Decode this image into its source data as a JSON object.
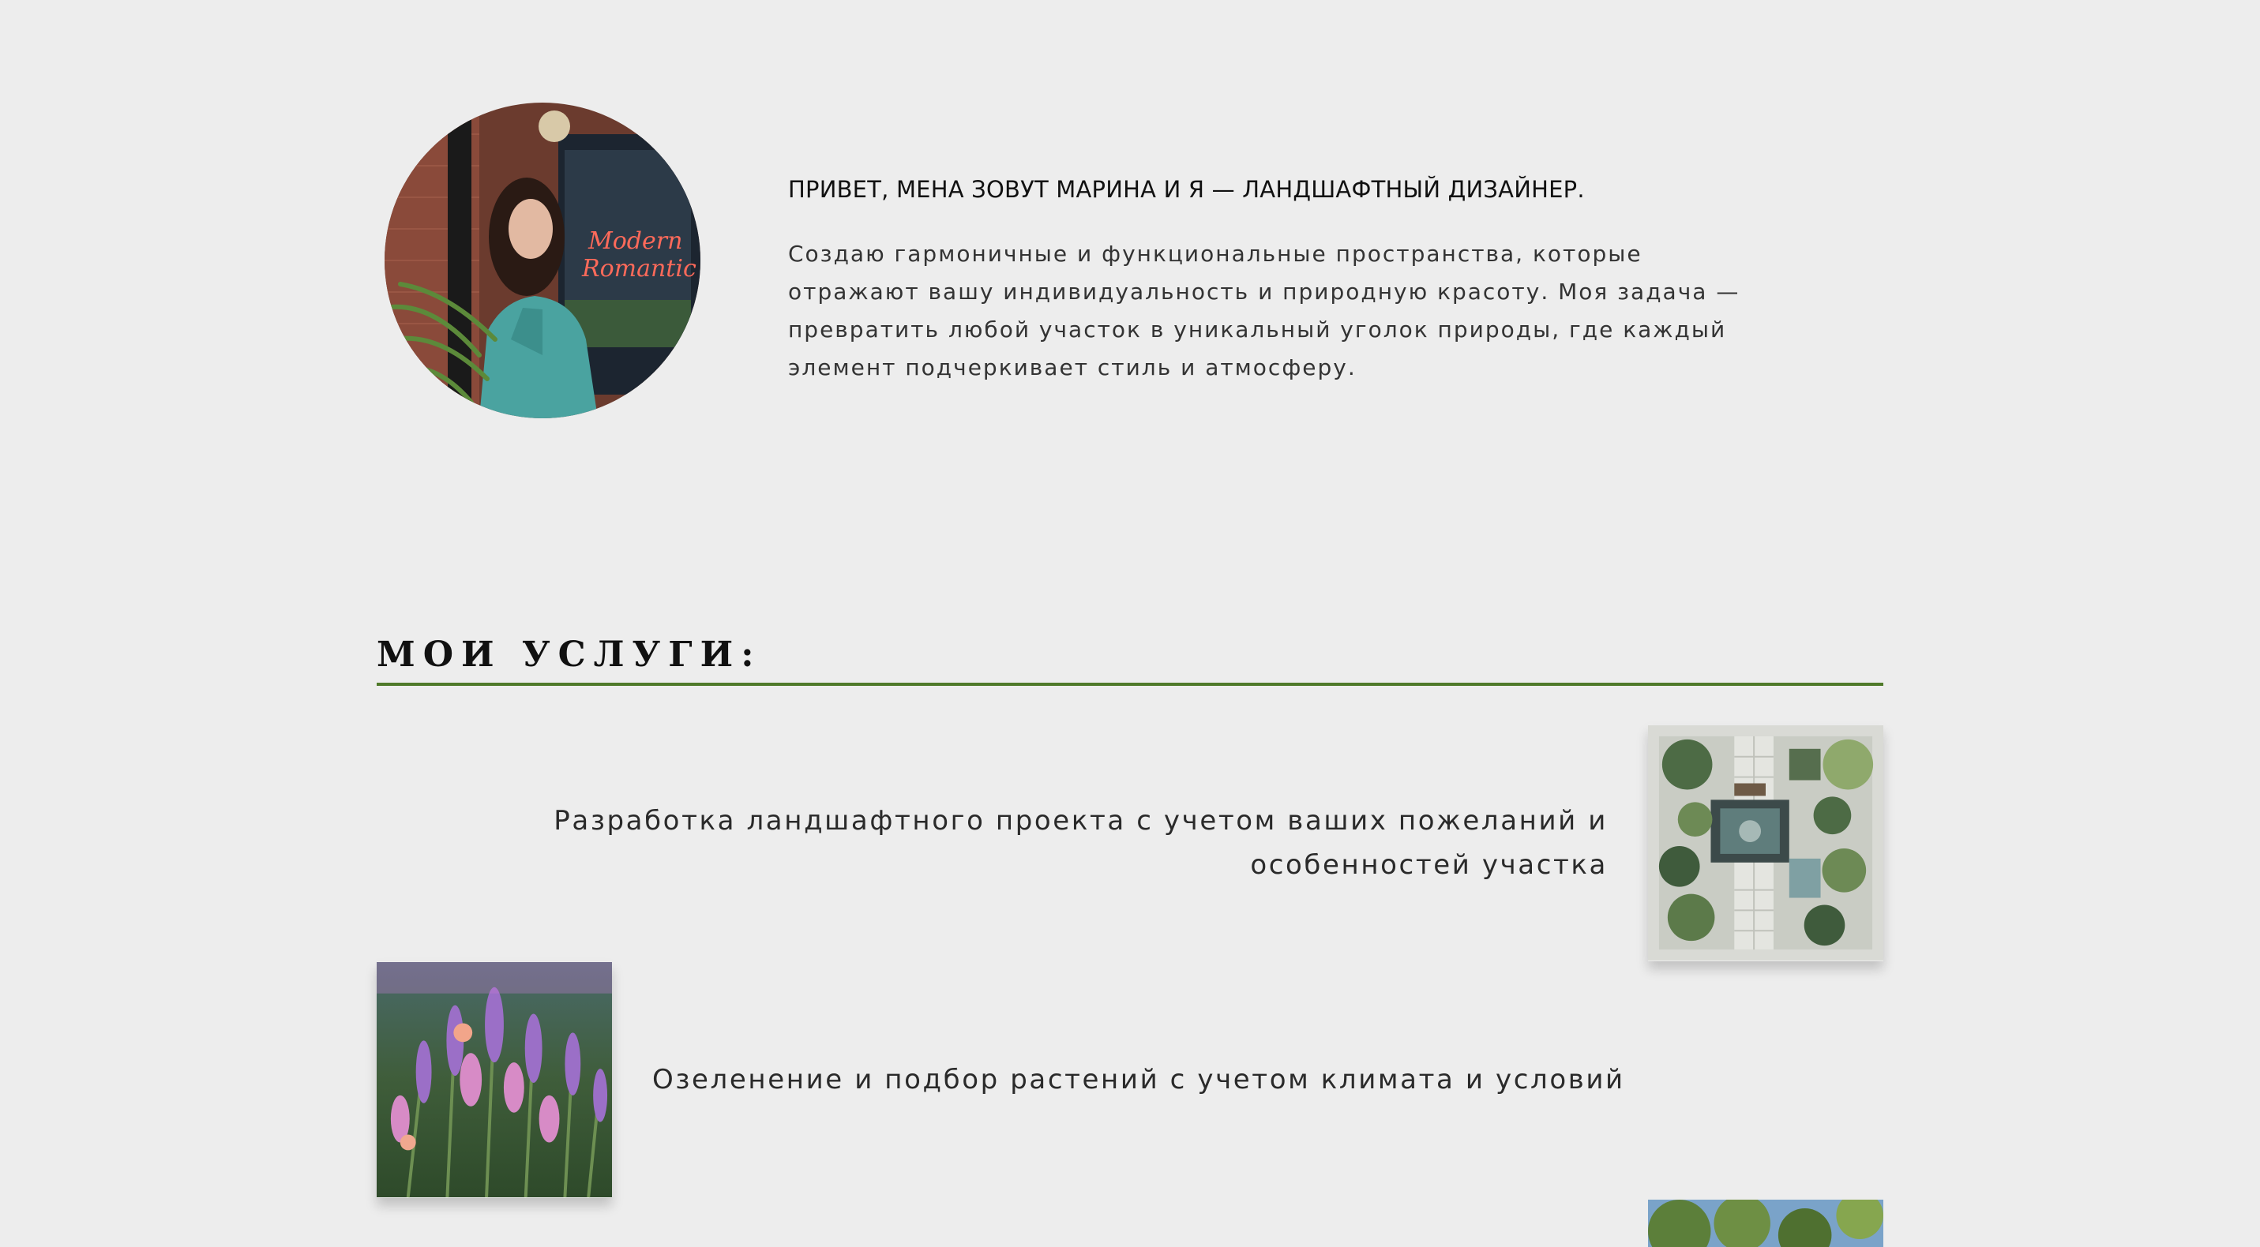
{
  "intro": {
    "heading": "ПРИВЕТ, МЕНА ЗОВУТ МАРИНА И Я — ЛАНДШАФТНЫЙ ДИЗАЙНЕР.",
    "text_lines": [
      "Создаю гармоничные и функциональные пространства, которые",
      "отражают вашу индивидуальность и природную красоту. Моя задача —",
      "превратить любой участок в уникальный уголок природы, где каждый",
      "элемент подчеркивает стиль и атмосферу."
    ],
    "photo_sign_text": [
      "Modern",
      "Romantic"
    ]
  },
  "services": {
    "title": "МОИ УСЛУГИ:",
    "accent_color": "#4f7a2a",
    "items": [
      {
        "lines": [
          "Разработка ландшафтного проекта с учетом ваших пожеланий и",
          "особенностей участка"
        ],
        "image_icon": "garden-plan-image"
      },
      {
        "lines": [
          "Озеленение и подбор растений с учетом климата и условий"
        ],
        "image_icon": "lavender-image"
      },
      {
        "lines": [],
        "image_icon": "trees-image"
      }
    ]
  },
  "colors": {
    "background": "#ededed",
    "text": "#222222"
  }
}
